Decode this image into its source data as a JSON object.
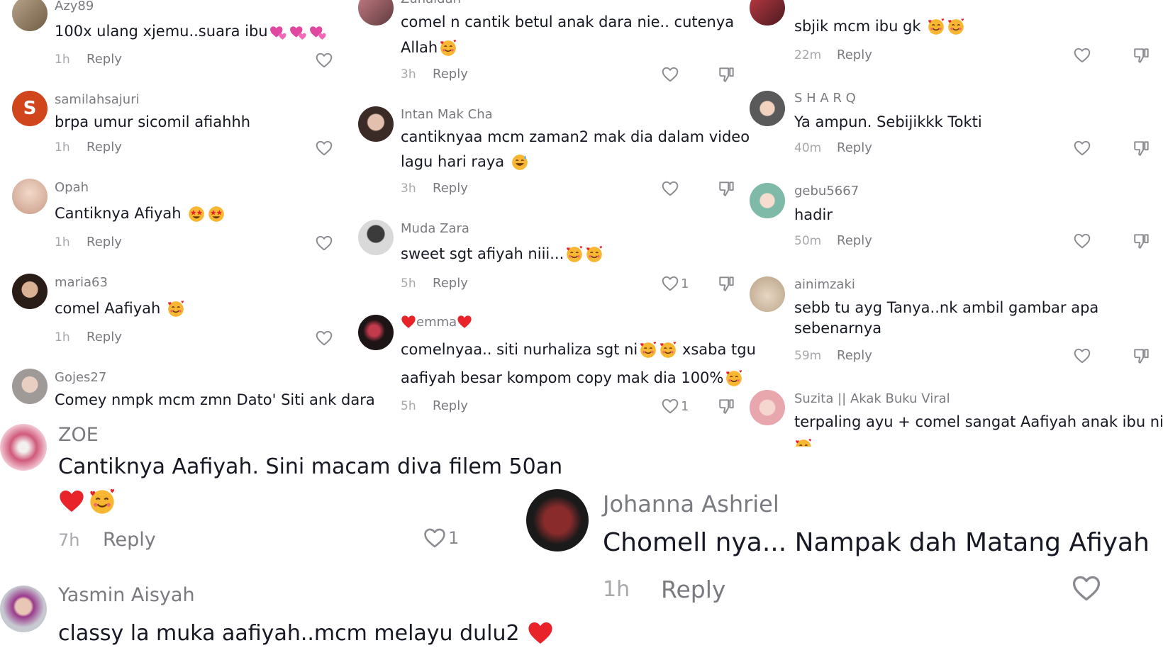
{
  "colors": {
    "text": "#161823",
    "username": "#7a7b80",
    "meta": "#a7a8ab",
    "heart_red": "#e8232a",
    "avatar_s": "#d1451c"
  },
  "icons": {
    "like": "heart-outline-icon",
    "dislike": "thumbs-down-icon",
    "emoji_love": "smiling-face-with-hearts-emoji",
    "emoji_heart": "red-heart-emoji",
    "emoji_two_hearts": "pink-hearts-emoji",
    "emoji_star_eyes": "star-struck-emoji",
    "emoji_sweat": "grinning-sweat-emoji"
  },
  "reply_label": "Reply",
  "col1": [
    {
      "user": "Azy89",
      "text": "100x ulang xjemu..suara ibu",
      "time": "1h",
      "likes": ""
    },
    {
      "user": "samilahsajuri",
      "avatar_letter": "S",
      "text": "brpa umur sicomil afiahhh",
      "time": "1h",
      "likes": ""
    },
    {
      "user": "Opah",
      "text": "Cantiknya Afiyah",
      "time": "1h",
      "likes": ""
    },
    {
      "user": "maria63",
      "text": "comel Aafiyah",
      "time": "1h",
      "likes": ""
    },
    {
      "user": "Gojes27",
      "text": "Comey nmpk mcm zmn Dato' Siti ank dara"
    }
  ],
  "col2": [
    {
      "user": "Zunaidah",
      "text": "comel n cantik betul anak dara nie.. cutenya",
      "text2": "Allah",
      "time": "3h",
      "likes": ""
    },
    {
      "user": "Intan Mak Cha",
      "text": "cantiknyaa mcm zaman2 mak dia dalam video",
      "text2": "lagu hari raya",
      "time": "3h",
      "likes": ""
    },
    {
      "user": "Muda Zara",
      "text": "sweet sgt afiyah niii...",
      "time": "5h",
      "likes": "1"
    },
    {
      "user": "emma",
      "text": "comelnyaa.. siti nurhaliza sgt ni",
      "text_mid": "xsaba tgu",
      "text2": "aafiyah besar kompom copy mak dia 100%",
      "time": "5h",
      "likes": "1"
    }
  ],
  "col3": [
    {
      "text": "sbjik mcm ibu gk",
      "time": "22m",
      "likes": ""
    },
    {
      "user": "S H A R Q",
      "text": "Ya ampun. Sebijikkk Tokti",
      "time": "40m",
      "likes": ""
    },
    {
      "user": "gebu5667",
      "text": "hadir",
      "time": "50m",
      "likes": ""
    },
    {
      "user": "ainimzaki",
      "text": "sebb tu ayg Tanya..nk ambil gambar apa",
      "text2": "sebenarnya",
      "time": "59m",
      "likes": ""
    },
    {
      "user": "Suzita || Akak Buku Viral",
      "text": "terpaling ayu + comel sangat Aafiyah anak ibu ni"
    }
  ],
  "big": [
    {
      "user": "ZOE",
      "text": "Cantiknya Aafiyah. Sini macam diva filem 50an",
      "time": "7h",
      "likes": "1"
    },
    {
      "user": "Yasmin Aisyah",
      "text": "classy la muka aafiyah..mcm melayu dulu2"
    },
    {
      "user": "Johanna Ashriel",
      "text": "Chomell nya... Nampak dah Matang Afiyah",
      "time": "1h",
      "likes": ""
    }
  ]
}
